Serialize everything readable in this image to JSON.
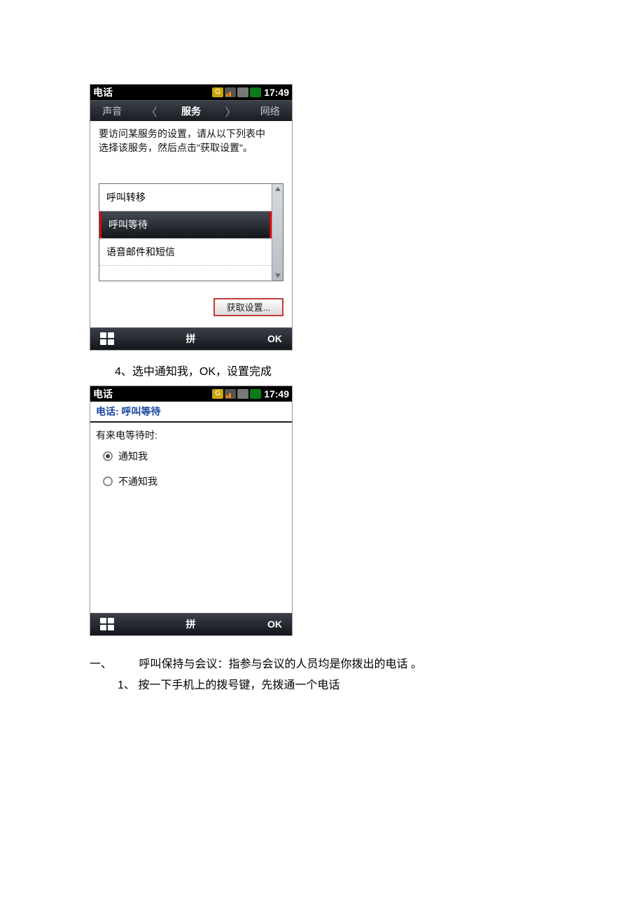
{
  "shot1": {
    "title": "电话",
    "time": "17:49",
    "icons": [
      "g",
      "signal",
      "sd",
      "battery"
    ],
    "tabs": {
      "left": "声音",
      "mid": "服务",
      "right": "网络"
    },
    "instr_l1": "要访问某服务的设置，请从以下列表中",
    "instr_l2": "选择该服务，然后点击\"获取设置\"。",
    "rows": {
      "r0": "呼叫转移",
      "r1": "呼叫等待",
      "r2": "语音邮件和短信"
    },
    "get_btn": "获取设置...",
    "soft_mid": "拼",
    "soft_right": "OK"
  },
  "step_4": "4、选中通知我，OK，设置完成",
  "shot2": {
    "title": "电话",
    "time": "17:49",
    "subtitle": "电话: 呼叫等待",
    "prompt": "有来电等待时:",
    "opt1": "通知我",
    "opt2": "不通知我",
    "soft_mid": "拼",
    "soft_right": "OK"
  },
  "heading": {
    "num": "一、",
    "text": "呼叫保持与会议：指参与会议的人员均是你拨出的电话 。"
  },
  "step_1b": "1、 按一下手机上的拨号键，先拨通一个电话"
}
